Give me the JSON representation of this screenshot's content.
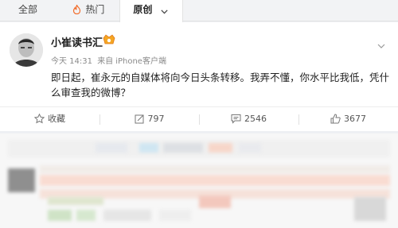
{
  "tabs": [
    {
      "label": "全部"
    },
    {
      "label": "热门"
    },
    {
      "label": "原创"
    }
  ],
  "post": {
    "author": "小崔读书汇",
    "time": "今天 14:31",
    "source_prefix": "来自",
    "source": "iPhone客户端",
    "text": "即日起，崔永元的自媒体将向今日头条转移。我弄不懂，你水平比我低，凭什么审查我的微博？"
  },
  "actions": {
    "favorite": "收藏",
    "repost": "797",
    "comment": "2546",
    "like": "3677"
  },
  "colors": {
    "hot_icon": "#f26c2a",
    "accent": "#f07a2a"
  }
}
